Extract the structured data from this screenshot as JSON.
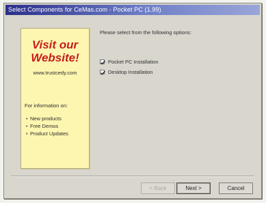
{
  "window": {
    "title": "Select Components for CeMas.com - Pocket PC (1.99)"
  },
  "ad_panel": {
    "headline_line1": "Visit our",
    "headline_line2": "Website!",
    "url": "www.trustcedy.com",
    "info_text": "For information on:",
    "items": [
      {
        "label": "New products"
      },
      {
        "label": "Free Demos"
      },
      {
        "label": "Product Updates"
      }
    ],
    "headline_color": "#c81d1d",
    "background_color": "#fdf6b0"
  },
  "content": {
    "prompt": "Please select from the following options:",
    "options": [
      {
        "label": "Pocket PC Installation",
        "checked": true
      },
      {
        "label": "Desktop Installation",
        "checked": true
      }
    ]
  },
  "buttons": {
    "back": "< Back",
    "next": "Next >",
    "cancel": "Cancel"
  }
}
